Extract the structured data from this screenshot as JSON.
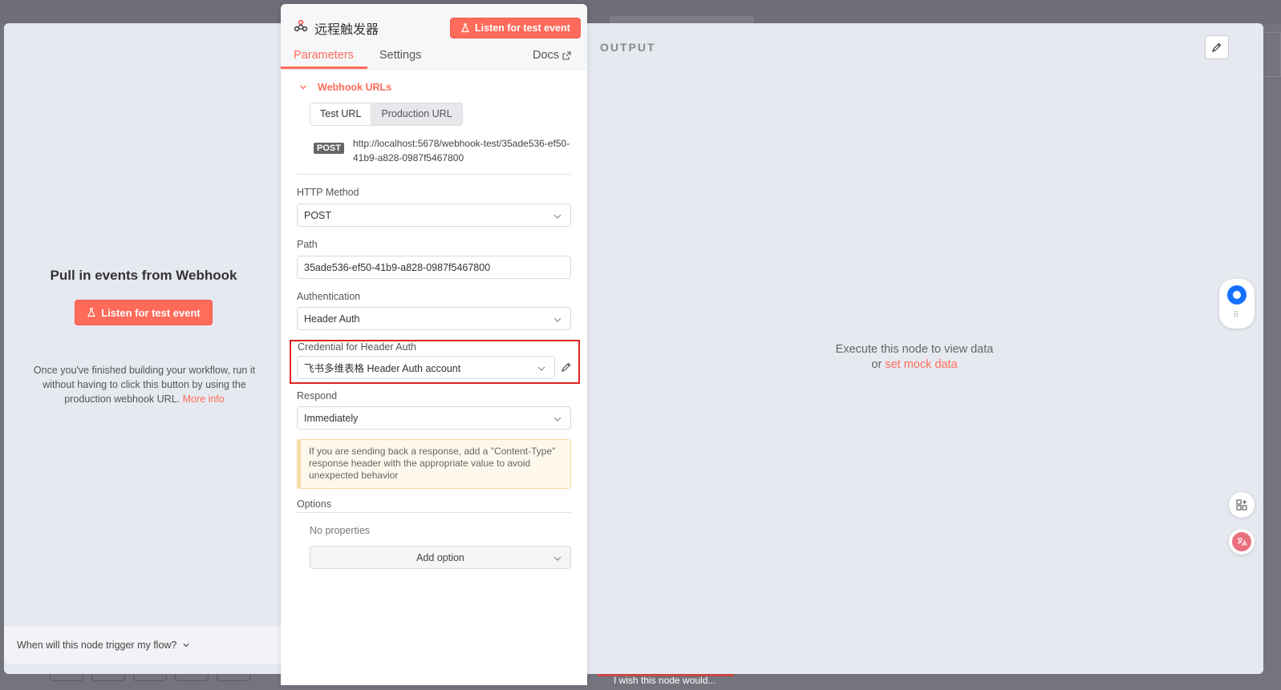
{
  "node": {
    "title": "远程触发器",
    "listen_label": "Listen for test event"
  },
  "tabs": [
    {
      "label": "Parameters"
    },
    {
      "label": "Settings"
    }
  ],
  "docs_label": "Docs",
  "left_panel": {
    "title": "Pull in events from Webhook",
    "listen_label": "Listen for test event",
    "description": "Once you've finished building your workflow, run it without having to click this button by using the production webhook URL.",
    "more_info": "More info",
    "footer_question": "When will this node trigger my flow?"
  },
  "webhook_urls": {
    "section_label": "Webhook URLs",
    "tab_test": "Test URL",
    "tab_production": "Production URL",
    "method_badge": "POST",
    "url": "http://localhost:5678/webhook-test/35ade536-ef50-41b9-a828-0987f5467800"
  },
  "fields": {
    "http_method": {
      "label": "HTTP Method",
      "value": "POST"
    },
    "path": {
      "label": "Path",
      "value": "35ade536-ef50-41b9-a828-0987f5467800"
    },
    "authentication": {
      "label": "Authentication",
      "value": "Header Auth"
    },
    "credential": {
      "label": "Credential for Header Auth",
      "value": "飞书多维表格 Header Auth account"
    },
    "respond": {
      "label": "Respond",
      "value": "Immediately"
    }
  },
  "notice": "If you are sending back a response, add a \"Content-Type\" response header with the appropriate value to avoid unexpected behavior",
  "options": {
    "label": "Options",
    "empty": "No properties",
    "add_label": "Add option"
  },
  "output": {
    "title": "OUTPUT",
    "empty_line1": "Execute this node to view data",
    "empty_or": "or",
    "mock_link": "set mock data"
  },
  "background": {
    "wish_text": "I wish this node would..."
  },
  "colors": {
    "accent": "#ff6d5a",
    "highlight_border": "#dd2222"
  }
}
